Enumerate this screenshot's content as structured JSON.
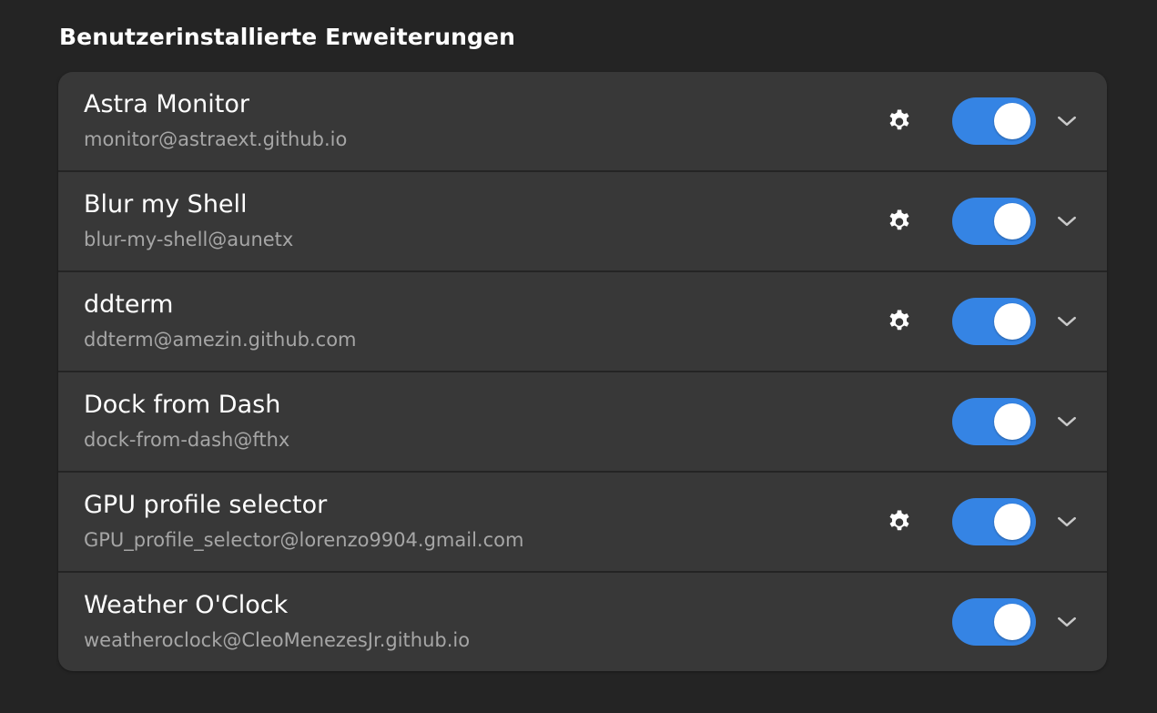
{
  "section": {
    "title": "Benutzerinstallierte Erweiterungen"
  },
  "colors": {
    "background": "#242424",
    "row_background": "#383838",
    "accent": "#3584e4",
    "subtitle": "#a6a6a6"
  },
  "extensions": [
    {
      "name": "Astra Monitor",
      "uuid": "monitor@astraext.github.io",
      "has_settings": true,
      "enabled": true,
      "settings_icon": "gear-icon",
      "expander_icon": "chevron-down-icon"
    },
    {
      "name": "Blur my Shell",
      "uuid": "blur-my-shell@aunetx",
      "has_settings": true,
      "enabled": true,
      "settings_icon": "gear-icon",
      "expander_icon": "chevron-down-icon"
    },
    {
      "name": "ddterm",
      "uuid": "ddterm@amezin.github.com",
      "has_settings": true,
      "enabled": true,
      "settings_icon": "gear-icon",
      "expander_icon": "chevron-down-icon"
    },
    {
      "name": "Dock from Dash",
      "uuid": "dock-from-dash@fthx",
      "has_settings": false,
      "enabled": true,
      "settings_icon": "gear-icon",
      "expander_icon": "chevron-down-icon"
    },
    {
      "name": "GPU profile selector",
      "uuid": "GPU_profile_selector@lorenzo9904.gmail.com",
      "has_settings": true,
      "enabled": true,
      "settings_icon": "gear-icon",
      "expander_icon": "chevron-down-icon"
    },
    {
      "name": "Weather O'Clock",
      "uuid": "weatheroclock@CleoMenezesJr.github.io",
      "has_settings": false,
      "enabled": true,
      "settings_icon": "gear-icon",
      "expander_icon": "chevron-down-icon"
    }
  ]
}
